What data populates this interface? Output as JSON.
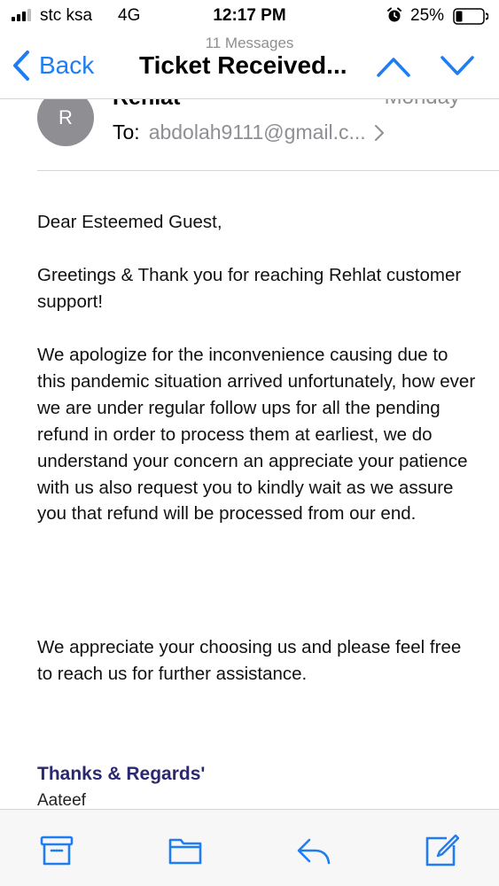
{
  "status_bar": {
    "carrier": "stc ksa",
    "network": "4G",
    "time": "12:17 PM",
    "battery": "25%"
  },
  "nav": {
    "message_count": "11 Messages",
    "back_label": "Back",
    "title": "Ticket Received..."
  },
  "email": {
    "avatar_initial": "R",
    "sender": "Rehlat",
    "date": "Monday",
    "to_label": "To:",
    "to_address": "abdolah9111@gmail.c..."
  },
  "body": {
    "greeting": "Dear Esteemed Guest,",
    "paragraph1": "Greetings & Thank you for reaching Rehlat customer support!",
    "paragraph2": "We apologize for the inconvenience causing due to this pandemic situation arrived unfortunately, how ever we are under regular follow ups for all the pending refund in order to process them at earliest, we do understand your concern an appreciate your patience with us also request you to kindly wait as we assure you that refund will be processed from our end.",
    "paragraph3": "We appreciate your choosing us and please feel free to reach us for further assistance.",
    "thanks": "Thanks & Regards'",
    "signer": "Aateef"
  },
  "toolbar": {
    "icons": [
      "archive-icon",
      "folder-icon",
      "reply-icon",
      "compose-icon"
    ]
  },
  "colors": {
    "accent": "#1f7df3",
    "signature": "#2b2872",
    "secondary_text": "#8e8e93"
  }
}
